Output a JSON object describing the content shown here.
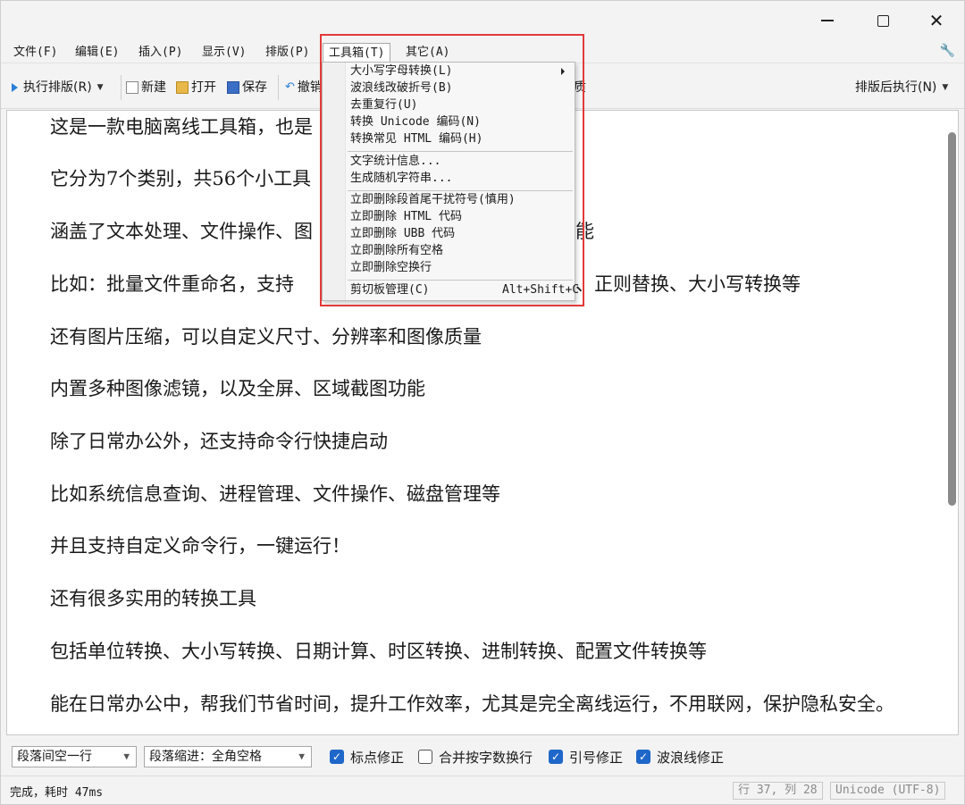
{
  "window": {
    "controls": {
      "minimize": "minimize",
      "maximize": "maximize",
      "close": "✕"
    }
  },
  "menubar": {
    "items": [
      "文件(F)",
      "编辑(E)",
      "插入(P)",
      "显示(V)",
      "排版(P)",
      "工具箱(T)",
      "其它(A)"
    ],
    "active_index": 5
  },
  "toolbar": {
    "run_label": "执行排版(R)",
    "new_label": "新建",
    "open_label": "打开",
    "save_label": "保存",
    "undo_label": "撤销",
    "undo_visible": "撤销",
    "after_label": "排版后执行(N)",
    "partial_right": "质"
  },
  "dropdown": {
    "groups": [
      [
        {
          "label": "大小写字母转换(L)",
          "submenu": true
        },
        {
          "label": "波浪线改破折号(B)"
        },
        {
          "label": "去重复行(U)"
        },
        {
          "label": "转换 Unicode 编码(N)"
        },
        {
          "label": "转换常见 HTML 编码(H)"
        }
      ],
      [
        {
          "label": "文字统计信息..."
        },
        {
          "label": "生成随机字符串..."
        }
      ],
      [
        {
          "label": "立即删除段首尾干扰符号(慎用)"
        },
        {
          "label": "立即删除 HTML 代码"
        },
        {
          "label": "立即删除 UBB 代码"
        },
        {
          "label": "立即删除所有空格"
        },
        {
          "label": "立即删除空换行"
        }
      ],
      [
        {
          "label": "剪切板管理(C)",
          "shortcut": "Alt+Shift+C"
        }
      ]
    ]
  },
  "editor": {
    "paragraphs": [
      "这是一款电脑离线工具箱，也是",
      "它分为7个类别，共56个小工具",
      "涵盖了文本处理、文件操作、图",
      "比如：批量文件重命名，支持",
      "还有图片压缩，可以自定义尺寸、分辨率和图像质量",
      "内置多种图像滤镜，以及全屏、区域截图功能",
      "除了日常办公外，还支持命令行快捷启动",
      "比如系统信息查询、进程管理、文件操作、磁盘管理等",
      "并且支持自定义命令行，一键运行！",
      "还有很多实用的转换工具",
      "包括单位转换、大小写转换、日期计算、时区转换、进制转换、配置文件转换等",
      "能在日常办公中，帮我们节省时间，提升工作效率，尤其是完全离线运行，不用联网，保护隐私安全。"
    ],
    "visible_tails": {
      "2": "能",
      "3": "、正则替换、大小写转换等"
    }
  },
  "options": {
    "paragraph_spacing": "段落间空一行",
    "indent": "段落缩进：全角空格",
    "checkboxes": [
      {
        "label": "标点修正",
        "checked": true
      },
      {
        "label": "合并按字数换行",
        "checked": false
      },
      {
        "label": "引号修正",
        "checked": true
      },
      {
        "label": "波浪线修正",
        "checked": true
      }
    ]
  },
  "status": {
    "message": "完成，耗时 47ms",
    "position": "行 37, 列 28",
    "encoding": "Unicode (UTF-8)"
  },
  "colors": {
    "accent": "#1f67c9",
    "highlight": "#e23a3a"
  }
}
